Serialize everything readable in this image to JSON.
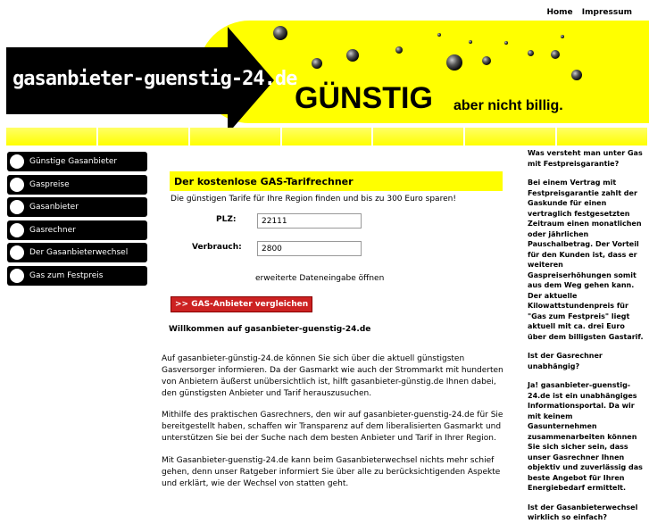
{
  "header": {
    "links": [
      "Home",
      "Impressum"
    ],
    "site_name": "gasanbieter-guenstig-24.de",
    "slogan_big": "GÜNSTIG",
    "slogan_small": "aber nicht billig."
  },
  "nav_tabs": 7,
  "menu": [
    "Günstige Gasanbieter",
    "Gaspreise",
    "Gasanbieter",
    "Gasrechner",
    "Der Gasanbieterwechsel",
    "Gas zum Festpreis"
  ],
  "calculator": {
    "title": "Der kostenlose GAS-Tarifrechner",
    "subtitle": "Die günstigen Tarife für Ihre Region finden und bis zu 300 Euro sparen!",
    "plz_label": "PLZ:",
    "plz_value": "22111",
    "usage_label": "Verbrauch:",
    "usage_value": "2800",
    "extended_link": "erweiterte Dateneingabe öffnen",
    "compare_button": ">> GAS-Anbieter vergleichen"
  },
  "welcome_title": "Willkommen auf gasanbieter-guenstig-24.de",
  "paragraphs": [
    "Auf gasanbieter-günstig-24.de können Sie sich über die aktuell günstigsten Gasversorger informieren. Da der Gasmarkt wie auch der Strommarkt mit hunderten von Anbietern äußerst unübersichtlich ist, hilft gasanbieter-günstig.de Ihnen dabei, den günstigsten Anbieter und Tarif herauszusuchen.",
    "Mithilfe des praktischen Gasrechners, den wir auf gasanbieter-guenstig-24.de für Sie bereitgestellt haben, schaffen wir Transparenz auf dem liberalisierten Gasmarkt und unterstützen Sie bei der Suche nach dem besten Anbieter und Tarif in Ihrer Region.",
    "Mit Gasanbieter-guenstig-24.de kann beim Gasanbieterwechsel nichts mehr schief gehen, denn unser Ratgeber informiert Sie über alle zu berücksichtigenden Aspekte und erklärt, wie der Wechsel von statten geht."
  ],
  "sidebar": [
    "Was versteht man unter Gas mit Festpreisgarantie?",
    "Bei einem Vertrag mit Festpreisgarantie zahlt der Gaskunde für einen vertraglich festgesetzten Zeitraum einen monatlichen oder jährlichen Pauschalbetrag. Der Vorteil für den Kunden ist, dass er weiteren Gaspreiserhöhungen somit aus dem Weg gehen kann. Der aktuelle Kilowattstundenpreis für \"Gas zum Festpreis\" liegt aktuell mit ca. drei Euro über dem billigsten Gastarif.",
    "Ist der Gasrechner unabhängig?",
    "Ja! gasanbieter-guenstig-24.de ist ein unabhängiges Informationsportal. Da wir mit keinem Gasunternehmen zusammenarbeiten können Sie sich sicher sein, dass unser Gasrechner Ihnen objektiv und zuverlässig das beste Angebot für Ihren Energiebedarf ermittelt.",
    "Ist der Gasanbieterwechsel wirklich so einfach?"
  ]
}
